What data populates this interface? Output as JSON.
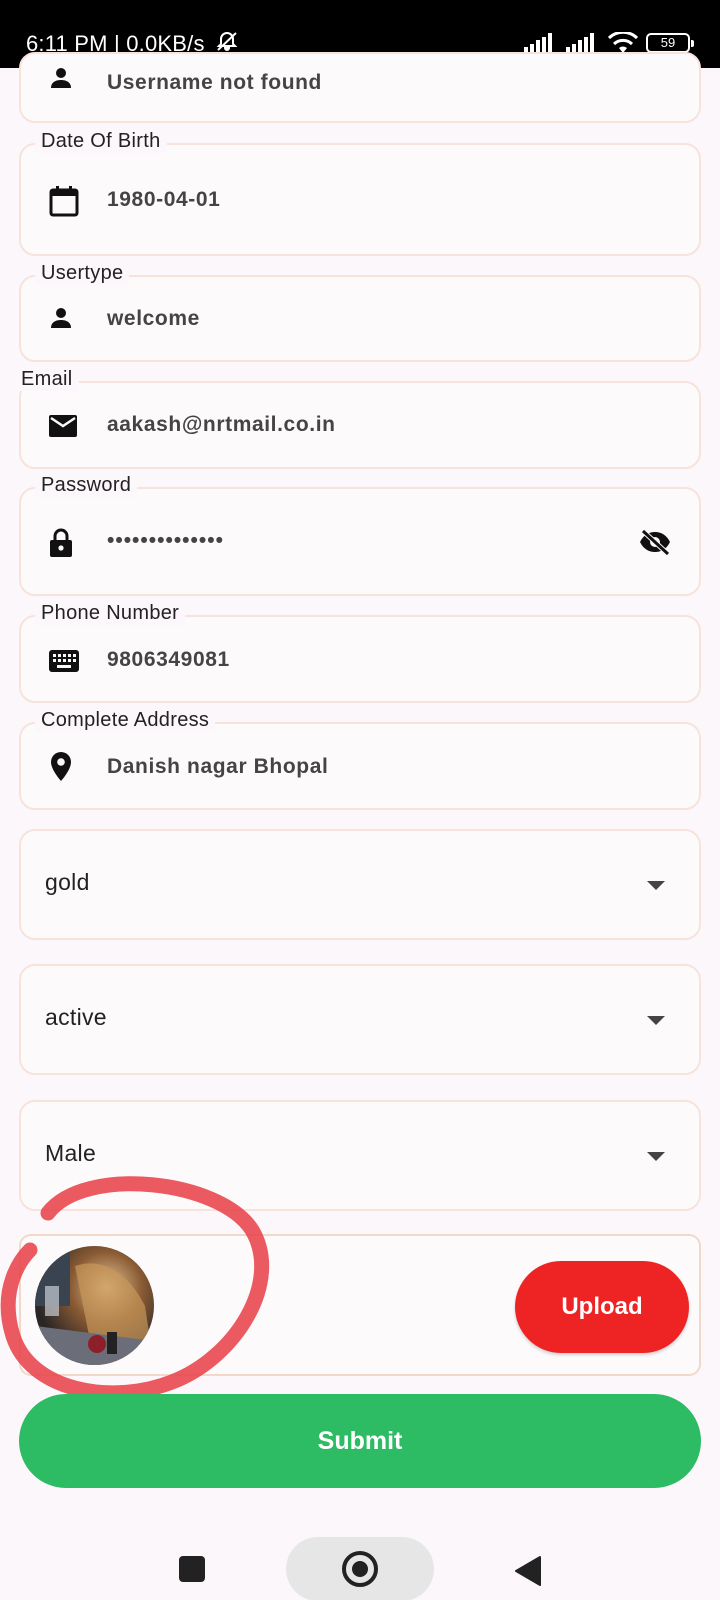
{
  "status_bar": {
    "time": "6:11 PM",
    "separator": " | ",
    "speed": "0.0KB/s",
    "battery": "59",
    "icons": [
      "bell-off-icon",
      "signal-icon",
      "signal-icon",
      "wifi-icon",
      "battery-icon"
    ]
  },
  "form": {
    "username": {
      "value": "Username not found",
      "icon": "person-icon"
    },
    "dob": {
      "label": "Date Of Birth",
      "value": "1980-04-01",
      "icon": "calendar-icon"
    },
    "usertype": {
      "label": "Usertype",
      "value": "welcome",
      "icon": "person-icon"
    },
    "email": {
      "label": "Email",
      "value": "aakash@nrtmail.co.in",
      "icon": "mail-icon"
    },
    "password": {
      "label": "Password",
      "value": "••••••••••••••",
      "icon": "lock-icon",
      "toggle_icon": "eye-off-icon"
    },
    "phone": {
      "label": "Phone Number",
      "value": "9806349081",
      "icon": "keyboard-icon"
    },
    "address": {
      "label": "Complete Address",
      "value": "Danish nagar Bhopal",
      "icon": "location-pin-icon"
    }
  },
  "dropdowns": [
    {
      "selected": "gold"
    },
    {
      "selected": "active"
    },
    {
      "selected": "Male"
    }
  ],
  "upload": {
    "button_label": "Upload"
  },
  "submit": {
    "label": "Submit"
  },
  "colors": {
    "upload_button": "#ee2424",
    "submit_button": "#2dbb63",
    "field_border": "#f7e3dc",
    "annotation_circle": "#e8484f"
  }
}
